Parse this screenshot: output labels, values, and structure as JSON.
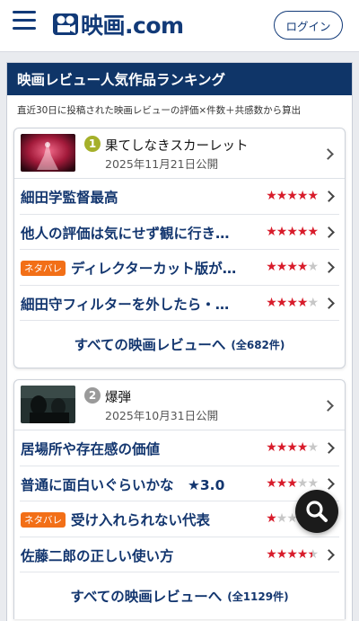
{
  "header": {
    "logo_text": "映画.com",
    "login_label": "ログイン"
  },
  "ranking": {
    "title": "映画レビュー人気作品ランキング",
    "note": "直近30日に投稿された映画レビューの評価×件数＋共感数から算出",
    "films": [
      {
        "rank": "1",
        "title": "果てしなきスカーレット",
        "date": "2025年11月21日公開",
        "rank_color": "#a5b02a",
        "reviews": [
          {
            "text": "細田学監督最高",
            "spoiler": "",
            "rating": 5
          },
          {
            "text": "他人の評価は気にせず観に行き…",
            "spoiler": "",
            "rating": 5
          },
          {
            "text": "ディレクターカット版が…",
            "spoiler": "ネタバレ",
            "rating": 4
          },
          {
            "text": "細田守フィルターを外したら・…",
            "spoiler": "",
            "rating": 4
          }
        ],
        "all_label": "すべての映画レビューへ",
        "all_count": "(全682件)"
      },
      {
        "rank": "2",
        "title": "爆弾",
        "date": "2025年10月31日公開",
        "rank_color": "#9a9a9a",
        "reviews": [
          {
            "text": "居場所や存在感の価値",
            "spoiler": "",
            "rating": 4
          },
          {
            "text": "普通に面白いぐらいかな　★3.0",
            "spoiler": "",
            "rating": 3
          },
          {
            "text": "受け入れられない代表",
            "spoiler": "ネタバレ",
            "rating": 1
          },
          {
            "text": "佐藤二郎の正しい使い方",
            "spoiler": "",
            "rating": 4.5
          }
        ],
        "all_label": "すべての映画レビューへ",
        "all_count": "(全1129件)"
      }
    ]
  },
  "colors": {
    "brand_navy": "#0f3568",
    "star_red": "#d81c2b",
    "spoiler_orange": "#f26f17"
  },
  "icons": [
    "menu-icon",
    "logo-camera-icon",
    "chevron-right-icon",
    "star-icon",
    "search-icon"
  ]
}
